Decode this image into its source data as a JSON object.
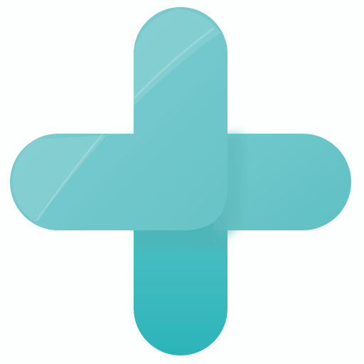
{
  "graphic": {
    "icon": "medical-cross-icon",
    "colors": {
      "background": "#fdfefe",
      "teal_light": "#86cfd2",
      "teal_mid": "#6cc5c9",
      "teal_dark": "#2bb5b9",
      "shadow": "#55b3b6"
    }
  }
}
